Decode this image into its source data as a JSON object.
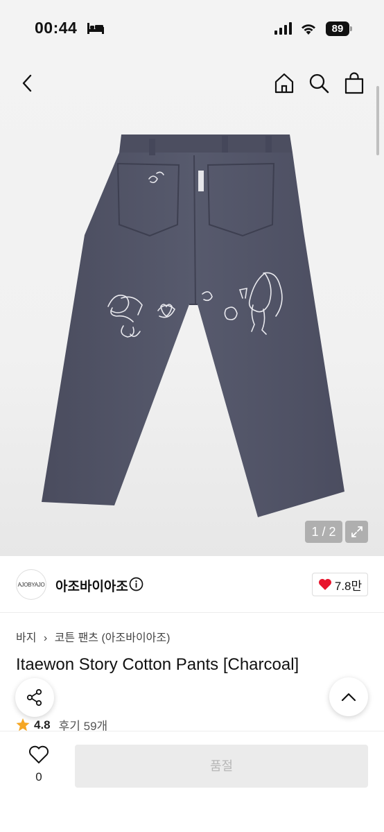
{
  "status_bar": {
    "time": "00:44",
    "battery": "89"
  },
  "gallery": {
    "counter": "1 / 2"
  },
  "brand": {
    "logo_text": "AJOBYAJO",
    "name": "아조바이아조",
    "likes": "7.8만"
  },
  "product": {
    "breadcrumb": [
      "바지",
      "코튼 팬츠 (아조바이아조)"
    ],
    "title": "Itaewon Story Cotton Pants [Charcoal]",
    "rating": "4.8",
    "reviews": "후기 59개"
  },
  "bottom": {
    "wish_count": "0",
    "buy_label": "품절"
  },
  "colors": {
    "accent_heart": "#e8142c",
    "pants": "#4f5163",
    "star": "#f5a623"
  },
  "icons": [
    "bed-icon",
    "signal-icon",
    "wifi-icon",
    "back-icon",
    "home-icon",
    "search-icon",
    "shopping-bag-icon",
    "expand-icon",
    "info-icon",
    "heart-icon",
    "star-icon",
    "share-icon",
    "chevron-up-icon"
  ]
}
